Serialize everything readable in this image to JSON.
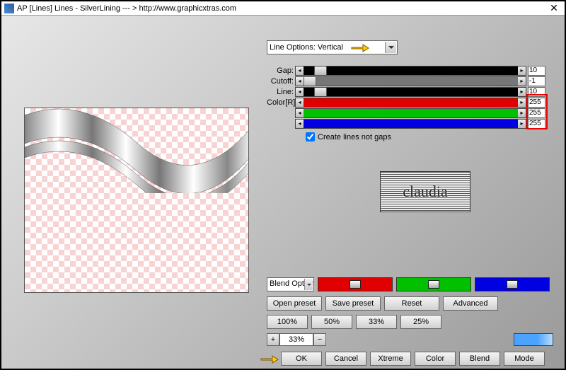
{
  "title": "AP [Lines]  Lines - SilverLining    --- >  http://www.graphicxtras.com",
  "combo_main": "Line Options: Vertical",
  "sliders": {
    "gap": {
      "label": "Gap:",
      "value": "10",
      "thumb_pct": 5
    },
    "cutoff": {
      "label": "Cutoff:",
      "value": "-1",
      "thumb_pct": 0
    },
    "line": {
      "label": "Line:",
      "value": "10",
      "thumb_pct": 5
    },
    "r": {
      "label": "Color[R]:",
      "value": "255",
      "color": "#e00000"
    },
    "g": {
      "label": "",
      "value": "255",
      "color": "#00c000"
    },
    "b": {
      "label": "",
      "value": "255",
      "color": "#0000e0"
    }
  },
  "checkbox_label": "Create lines not gaps",
  "checkbox_checked": true,
  "logo_text": "claudia",
  "combo_blend": "Blend Option",
  "rgb_mix": {
    "r": "#e00000",
    "g": "#00c000",
    "b": "#0000e0"
  },
  "preset_buttons": {
    "open": "Open preset",
    "save": "Save preset",
    "reset": "Reset",
    "advanced": "Advanced"
  },
  "percent_buttons": {
    "p100": "100%",
    "p50": "50%",
    "p33": "33%",
    "p25": "25%"
  },
  "spinner_value": "33%",
  "bottom_buttons": {
    "ok": "OK",
    "cancel": "Cancel",
    "xtreme": "Xtreme",
    "color": "Color",
    "blend": "Blend",
    "mode": "Mode"
  }
}
